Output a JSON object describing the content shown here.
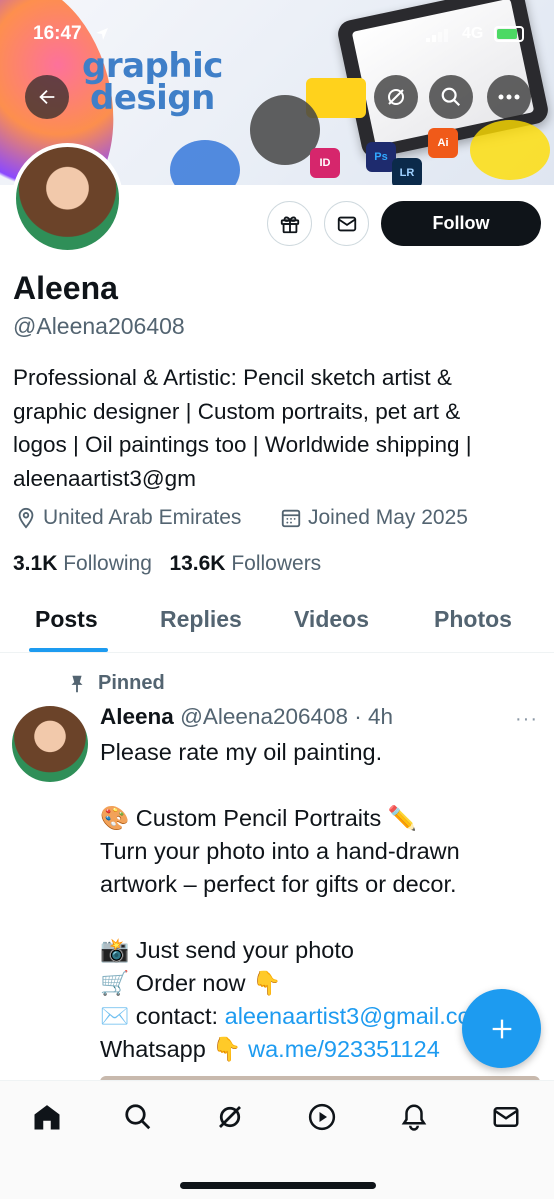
{
  "status_bar": {
    "time": "16:47",
    "network": "4G"
  },
  "banner": {
    "text_line1": "graphic",
    "text_line2": "design",
    "app_badges": [
      "ID",
      "Ps",
      "LR",
      "Ai"
    ]
  },
  "header_actions": {
    "back_icon": "back-arrow-icon",
    "grok_icon": "grok-icon",
    "search_icon": "search-icon",
    "more_icon": "more-icon"
  },
  "profile": {
    "name": "Aleena",
    "handle": "@Aleena206408",
    "bio_lines": [
      "Professional & Artistic: Pencil sketch artist &",
      "graphic designer | Custom portraits, pet art &",
      "logos | Oil paintings too | Worldwide shipping |",
      "aleenaartist3@gm"
    ],
    "location": "United Arab Emirates",
    "joined": "Joined May 2025",
    "following_count": "3.1K",
    "following_label": "Following",
    "followers_count": "13.6K",
    "followers_label": "Followers",
    "follow_label": "Follow"
  },
  "tabs": [
    {
      "label": "Posts",
      "active": true
    },
    {
      "label": "Replies",
      "active": false
    },
    {
      "label": "Videos",
      "active": false
    },
    {
      "label": "Photos",
      "active": false
    }
  ],
  "post": {
    "pinned_label": "Pinned",
    "author": "Aleena",
    "handle_time": "@Aleena206408 · 4h",
    "more": "···",
    "lines": [
      "Please rate my oil painting.",
      "",
      "🎨 Custom Pencil Portraits ✏️",
      "Turn your photo into a hand-drawn",
      "artwork – perfect for gifts or decor.",
      "",
      "📸 Just send your photo",
      "🛒 Order now 👇"
    ],
    "contact_prefix": "✉️ contact: ",
    "contact_link": "aleenaartist3@gmail.com",
    "whatsapp_prefix": "Whatsapp 👇 ",
    "whatsapp_link": "wa.me/923351124"
  },
  "fab": {
    "icon": "plus-icon"
  },
  "bottom_nav": [
    "home-icon",
    "search-icon",
    "grok-icon",
    "play-icon",
    "bell-icon",
    "mail-icon"
  ],
  "colors": {
    "accent": "#1d9bf0",
    "text": "#0f1419",
    "muted": "#536471"
  }
}
